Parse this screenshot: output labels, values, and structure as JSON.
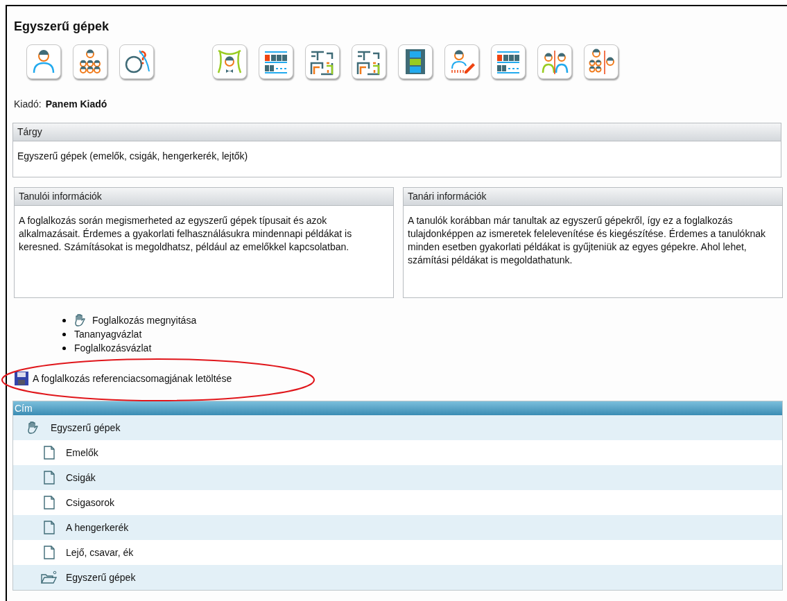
{
  "title": "Egyszerű gépek",
  "toolbar": [
    {
      "kind": "teacher"
    },
    {
      "kind": "group"
    },
    {
      "kind": "question"
    },
    {
      "kind": "stage"
    },
    {
      "kind": "text"
    },
    {
      "kind": "maze"
    },
    {
      "kind": "maze"
    },
    {
      "kind": "film"
    },
    {
      "kind": "writing"
    },
    {
      "kind": "text"
    },
    {
      "kind": "pair"
    },
    {
      "kind": "split"
    }
  ],
  "publisher": {
    "label": "Kiadó:",
    "value": "Panem Kiadó"
  },
  "subject": {
    "heading": "Tárgy",
    "text": "Egyszerű gépek (emelők, csigák, hengerkerék, lejtők)"
  },
  "info_panels": [
    {
      "heading": "Tanulói információk",
      "text": "A foglalkozás során megismerheted az egyszerű gépek típusait és azok alkalmazásait. Érdemes a gyakorlati felhasználásukra mindennapi példákat is keresned. Számításokat is megoldhatsz, például az emelőkkel kapcsolatban."
    },
    {
      "heading": "Tanári információk",
      "text": "A tanulók korábban már tanultak az egyszerű gépekről, így ez a foglalkozás tulajdonképpen az ismeretek felelevenítése és kiegészítése. Érdemes a tanulóknak minden esetben gyakorlati példákat is gyűjteniük az egyes gépekre. Ahol lehet, számítási példákat is megoldathatunk."
    }
  ],
  "links": [
    {
      "label": "Foglalkozás megnyitása",
      "kind": "lesson"
    },
    {
      "label": "Tananyagvázlat",
      "kind": "plain"
    },
    {
      "label": "Foglalkozásvázlat",
      "kind": "plain"
    }
  ],
  "download": {
    "label": "A foglalkozás referenciacsomagjának letöltése",
    "highlighted": true
  },
  "table": {
    "column": "Cím",
    "rows": [
      {
        "label": "Egyszerű gépek",
        "kind": "lesson",
        "children": [
          {
            "label": "Emelők",
            "kind": "page"
          },
          {
            "label": "Csigák",
            "kind": "page"
          },
          {
            "label": "Csigasorok",
            "kind": "page"
          },
          {
            "label": "A hengerkerék",
            "kind": "page"
          },
          {
            "label": "Lejő, csavar, ék",
            "kind": "page"
          },
          {
            "label": "Egyszerű gépek",
            "kind": "folder"
          }
        ]
      }
    ]
  }
}
